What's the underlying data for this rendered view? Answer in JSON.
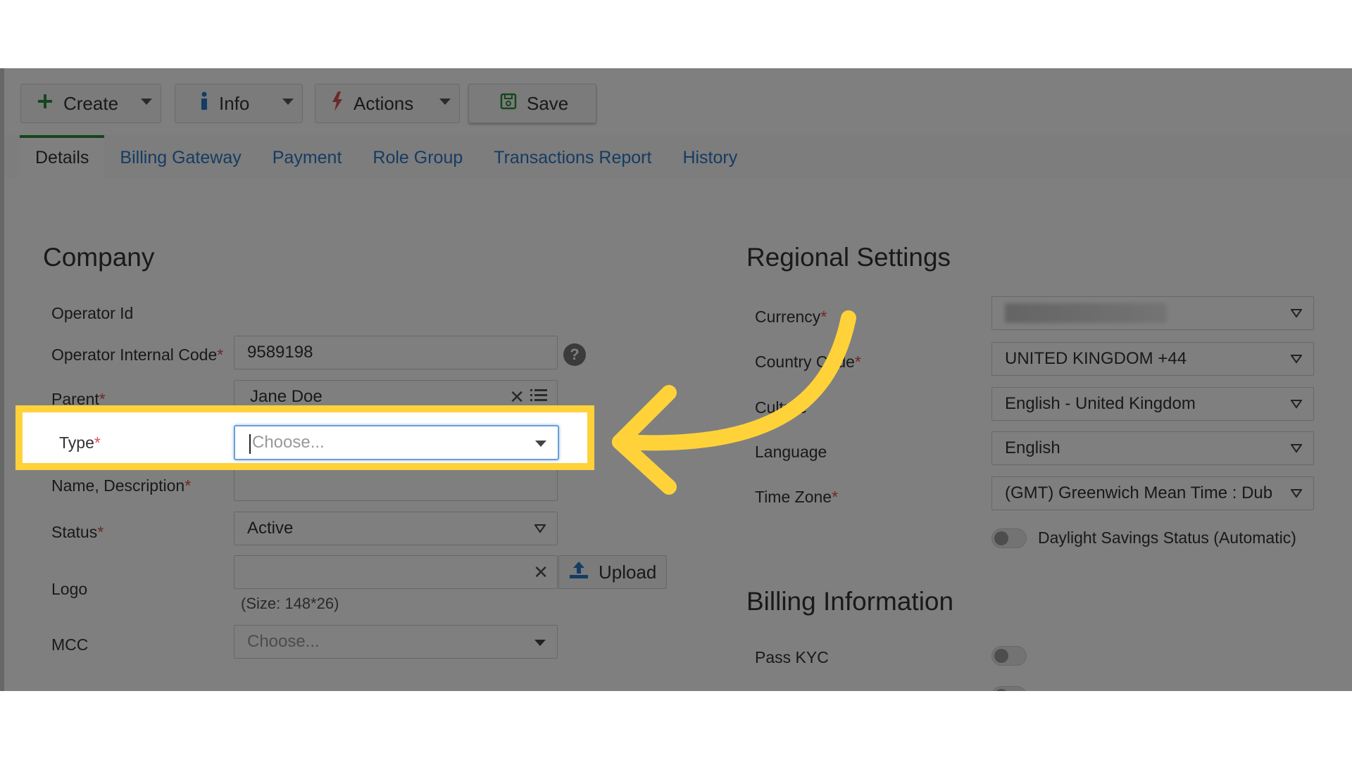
{
  "toolbar": {
    "create_label": "Create",
    "info_label": "Info",
    "actions_label": "Actions",
    "save_label": "Save"
  },
  "tabs": [
    {
      "label": "Details",
      "active": true
    },
    {
      "label": "Billing Gateway"
    },
    {
      "label": "Payment"
    },
    {
      "label": "Role Group"
    },
    {
      "label": "Transactions Report"
    },
    {
      "label": "History"
    }
  ],
  "company": {
    "title": "Company",
    "operator_id_label": "Operator Id",
    "operator_internal_code_label": "Operator Internal Code",
    "operator_internal_code_value": "9589198",
    "parent_label": "Parent",
    "parent_value": "Jane Doe",
    "type_label": "Type",
    "type_placeholder": "Choose...",
    "name_label": "Name, Description",
    "status_label": "Status",
    "status_value": "Active",
    "logo_label": "Logo",
    "upload_label": "Upload",
    "logo_hint": "(Size: 148*26)",
    "mcc_label": "MCC",
    "mcc_placeholder": "Choose..."
  },
  "regional": {
    "title": "Regional Settings",
    "currency_label": "Currency",
    "currency_value": "",
    "country_code_label": "Country Code",
    "country_code_value": "UNITED KINGDOM +44",
    "culture_label": "Culture",
    "culture_value": "English - United Kingdom",
    "language_label": "Language",
    "language_value": "English",
    "time_zone_label": "Time Zone",
    "time_zone_value": "(GMT) Greenwich Mean Time : Dub",
    "dst_label": "Daylight Savings Status (Automatic)"
  },
  "billing": {
    "title": "Billing Information",
    "pass_kyc_label": "Pass KYC"
  },
  "required_marker": "*",
  "colors": {
    "highlight": "#ffd23a",
    "link": "#2a78c4",
    "active_tab_border": "#2e8b3a",
    "required": "#d9534f"
  }
}
